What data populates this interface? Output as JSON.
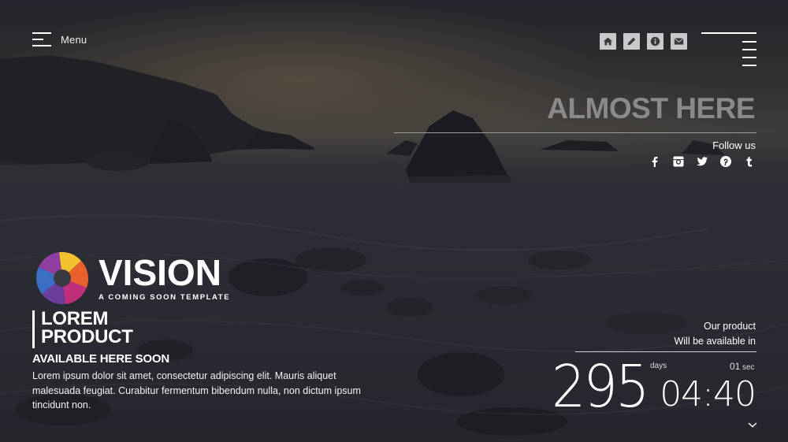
{
  "menu": {
    "label": "Menu"
  },
  "top_icons": [
    {
      "name": "home-icon"
    },
    {
      "name": "pencil-icon"
    },
    {
      "name": "info-icon"
    },
    {
      "name": "mail-icon"
    }
  ],
  "hero": {
    "headline": "ALMOST HERE",
    "follow_label": "Follow us",
    "socials": [
      "facebook-icon",
      "instagram-icon",
      "twitter-icon",
      "pinterest-icon",
      "tumblr-icon"
    ]
  },
  "logo": {
    "name": "VISION",
    "tagline": "A COMING SOON TEMPLATE",
    "colors": [
      "#f2c12e",
      "#e8612c",
      "#c0307a",
      "#6a3d9a",
      "#3a6fc4"
    ]
  },
  "product": {
    "title_line1": "LOREM",
    "title_line2": "PRODUCT",
    "subtitle": "AVAILABLE HERE SOON",
    "description": "Lorem ipsum dolor sit amet, consectetur adipiscing elit. Mauris aliquet malesuada feugiat. Curabitur fermentum bibendum nulla, non dictum ipsum tincidunt non."
  },
  "countdown": {
    "heading_line1": "Our product",
    "heading_line2": "Will be available in",
    "days": "295",
    "days_label": "days",
    "time": "04:40",
    "seconds": "01",
    "seconds_label": "sec"
  }
}
